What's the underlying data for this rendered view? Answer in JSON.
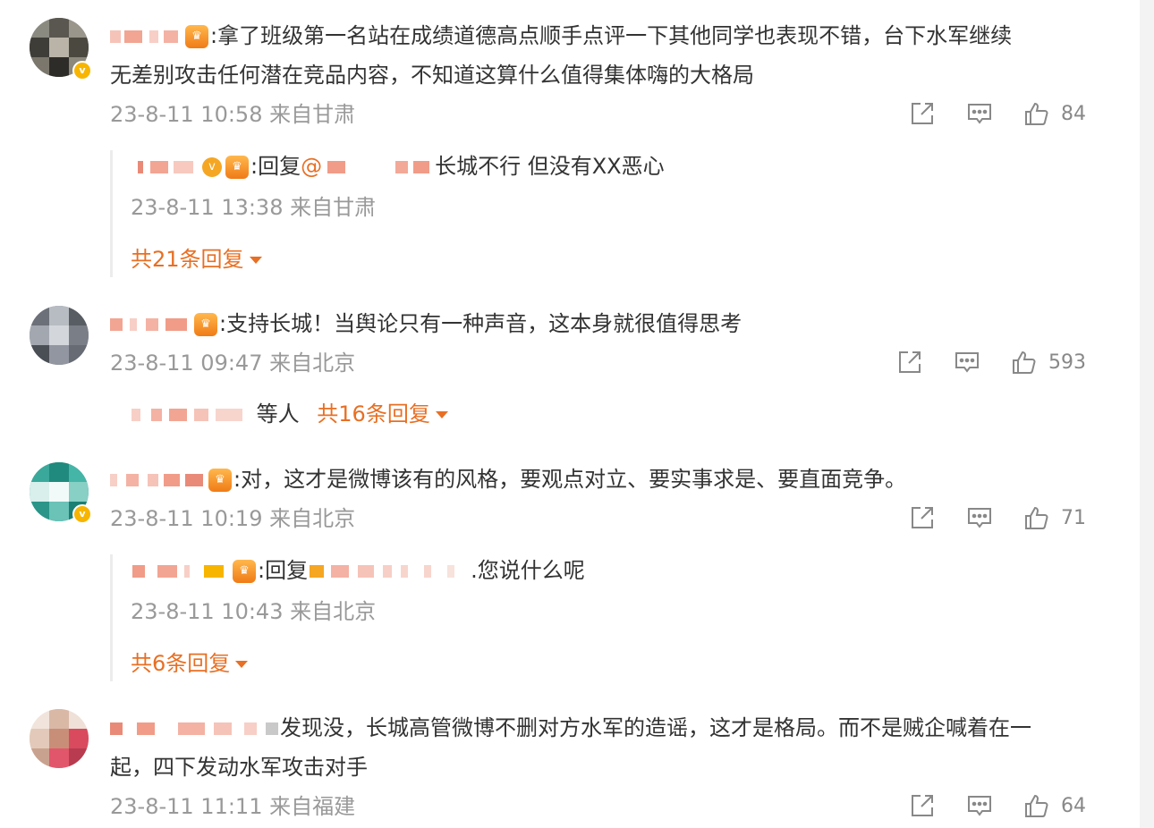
{
  "comments": [
    {
      "text": ":拿了班级第一名站在成绩道德高点顺手点评一下其他同学也表现不错，台下水军继续",
      "text2": "无差别攻击任何潜在竞品内容，不知道这算什么值得集体嗨的大格局",
      "time": "23-8-11 10:58 来自甘肃",
      "likes": "84",
      "reply": {
        "prefix": ":回复",
        "at": "@",
        "text": "长城不行   但没有XX恶心",
        "time": "23-8-11 13:38 来自甘肃"
      },
      "more": "共21条回复"
    },
    {
      "text": ":支持长城！当舆论只有一种声音，这本身就很值得思考",
      "time": "23-8-11 09:47 来自北京",
      "likes": "593",
      "summary_suffix": "等人",
      "more": "共16条回复"
    },
    {
      "text": ":对，这才是微博该有的风格，要观点对立、要实事求是、要直面竞争。",
      "time": "23-8-11 10:19 来自北京",
      "likes": "71",
      "reply": {
        "prefix": ":回复",
        "text": ".您说什么呢",
        "time": "23-8-11 10:43 来自北京"
      },
      "more": "共6条回复"
    },
    {
      "text": "发现没，长城高管微博不删对方水军的造谣，这才是格局。而不是贼企喊着在一",
      "text2": "起，四下发动水军攻击对手",
      "time": "23-8-11 11:11 来自福建",
      "likes": "64"
    }
  ],
  "icons": {
    "share": "share-icon",
    "comment": "comment-icon",
    "like": "like-icon",
    "caret": "chevron-down-icon"
  },
  "colors": {
    "accent": "#e86f23",
    "meta": "#999999",
    "text": "#333333"
  }
}
